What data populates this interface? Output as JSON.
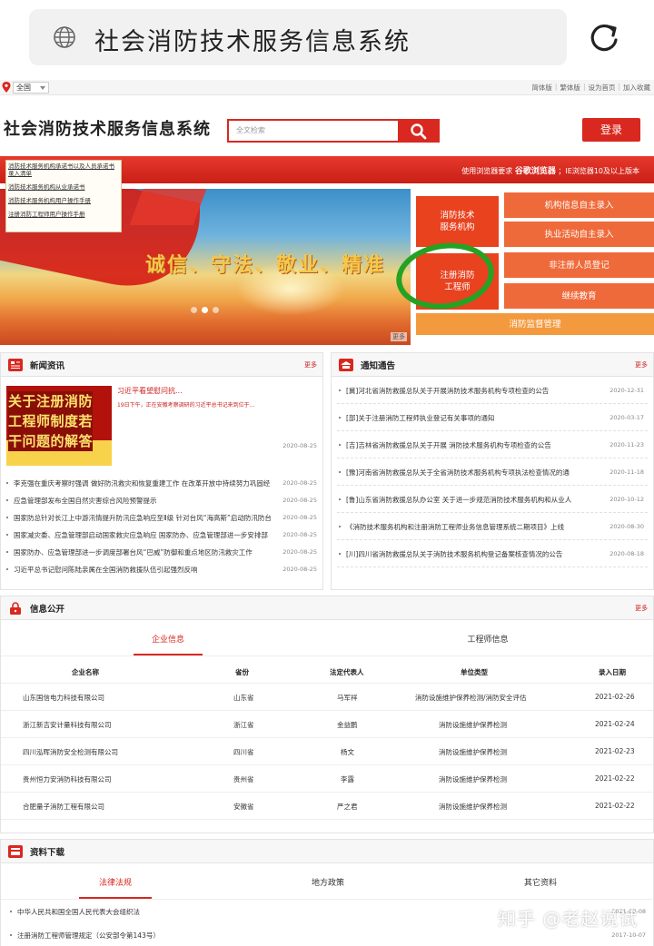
{
  "browser": {
    "url_title": "社会消防技术服务信息系统"
  },
  "topbar": {
    "region": "全国",
    "links": [
      "简体版",
      "繁体版",
      "设为首页",
      "加入收藏"
    ]
  },
  "header": {
    "site_title": "社会消防技术服务信息系统",
    "search_placeholder": "全文检索",
    "login_label": "登录"
  },
  "notice_bar": {
    "prefix": "使用浏览器要求",
    "browser": "谷歌浏览器",
    "suffix": "；IE浏览器10及以上版本"
  },
  "dropdown": {
    "items": [
      "消防技术服务机构承诺书以及人员承诺书录入清单",
      "消防技术服务机构从业承诺书",
      "消防技术服务机构用户操作手册",
      "注册消防工程师用户操作手册"
    ]
  },
  "banner": {
    "slogan": "诚信、守法、敬业、精准",
    "more": "更多"
  },
  "tiles": {
    "agency": "消防技术\n服务机构",
    "engineer": "注册消防\n工程师",
    "org_info": "机构信息自主录入",
    "practice": "执业活动自主录入",
    "non_registered": "非注册人员登记",
    "continuing_edu": "继续教育",
    "supervision": "消防监督管理"
  },
  "news": {
    "title": "新闻资讯",
    "more": "更多",
    "image_text": [
      "关于注册消防",
      "工程师制度若",
      "干问题的解答"
    ],
    "featured_title": "习近平看望慰问抗...",
    "featured_sub": "19日下午，正在安徽考察调研的习近平总书记来到位于...",
    "featured_date": "2020-08-25",
    "items": [
      {
        "text": "李克强在重庆考察时强调 做好防汛救灾和恢复重建工作 在改革开放中持续努力巩固经",
        "date": "2020-08-25"
      },
      {
        "text": "应急管理部发布全国自然灾害综合风险预警提示",
        "date": "2020-08-25"
      },
      {
        "text": "国家防总针对长江上中游汛情提升防汛应急响应至Ⅱ级 针对台风“海高斯”启动防汛防台",
        "date": "2020-08-25"
      },
      {
        "text": "国家减灾委、应急管理部启动国家救灾应急响应 国家防办、应急管理部进一步安排部",
        "date": "2020-08-25"
      },
      {
        "text": "国家防办、应急管理部进一步调度部署台风“巴威”防御和重点地区防汛救灾工作",
        "date": "2020-08-25"
      },
      {
        "text": "习近平总书记慰问陈陆亲属在全国消防救援队伍引起强烈反响",
        "date": "2020-08-25"
      }
    ]
  },
  "notices": {
    "title": "通知通告",
    "more": "更多",
    "items": [
      {
        "text": "[冀]河北省消防救援总队关于开展消防技术服务机构专项检查的公告",
        "date": "2020-12-31"
      },
      {
        "text": "[部]关于注册消防工程师执业登记有关事项的通知",
        "date": "2020-03-17"
      },
      {
        "text": "[吉]吉林省消防救援总队关于开展 消防技术服务机构专项检查的公告",
        "date": "2020-11-23"
      },
      {
        "text": "[豫]河南省消防救援总队关于全省消防技术服务机构专项执法检查情况的通",
        "date": "2020-11-18"
      },
      {
        "text": "[鲁]山东省消防救援总队办公室 关于进一步规范消防技术服务机构和从业人",
        "date": "2020-10-12"
      },
      {
        "text": "《消防技术服务机构和注册消防工程师业务信息管理系统二期项目》上线",
        "date": "2020-08-30"
      },
      {
        "text": "[川]四川省消防救援总队关于消防技术服务机构登记备案核查情况的公告",
        "date": "2020-08-18"
      }
    ]
  },
  "info": {
    "title": "信息公开",
    "more": "更多",
    "tabs": [
      "企业信息",
      "工程师信息"
    ],
    "columns": [
      "企业名称",
      "省份",
      "法定代表人",
      "单位类型",
      "录入日期"
    ],
    "rows": [
      [
        "山东国信电力科技有限公司",
        "山东省",
        "马军祥",
        "消防设施维护保养检测/消防安全评估",
        "2021-02-26"
      ],
      [
        "浙江新吉安计量科技有限公司",
        "浙江省",
        "金益鹏",
        "消防设施维护保养检测",
        "2021-02-24"
      ],
      [
        "四川泓晖消防安全检测有限公司",
        "四川省",
        "杨文",
        "消防设施维护保养检测",
        "2021-02-23"
      ],
      [
        "贵州恒力安消防科技有限公司",
        "贵州省",
        "李露",
        "消防设施维护保养检测",
        "2021-02-22"
      ],
      [
        "合肥量子消防工程有限公司",
        "安徽省",
        "严之君",
        "消防设施维护保养检测",
        "2021-02-22"
      ]
    ]
  },
  "downloads": {
    "title": "资料下载",
    "tabs": [
      "法律法规",
      "地方政策",
      "其它资料"
    ],
    "items": [
      {
        "text": "中华人民共和国全国人民代表大会组织法",
        "date": "2021-03-08"
      },
      {
        "text": "注册消防工程师管理规定（公安部令第143号）",
        "date": "2017-10-07"
      }
    ]
  },
  "watermark": "知乎 @老赵说试",
  "colors": {
    "brand_red": "#d9281f",
    "tile_orange": "#e8421f",
    "highlight_green": "#24a224"
  }
}
